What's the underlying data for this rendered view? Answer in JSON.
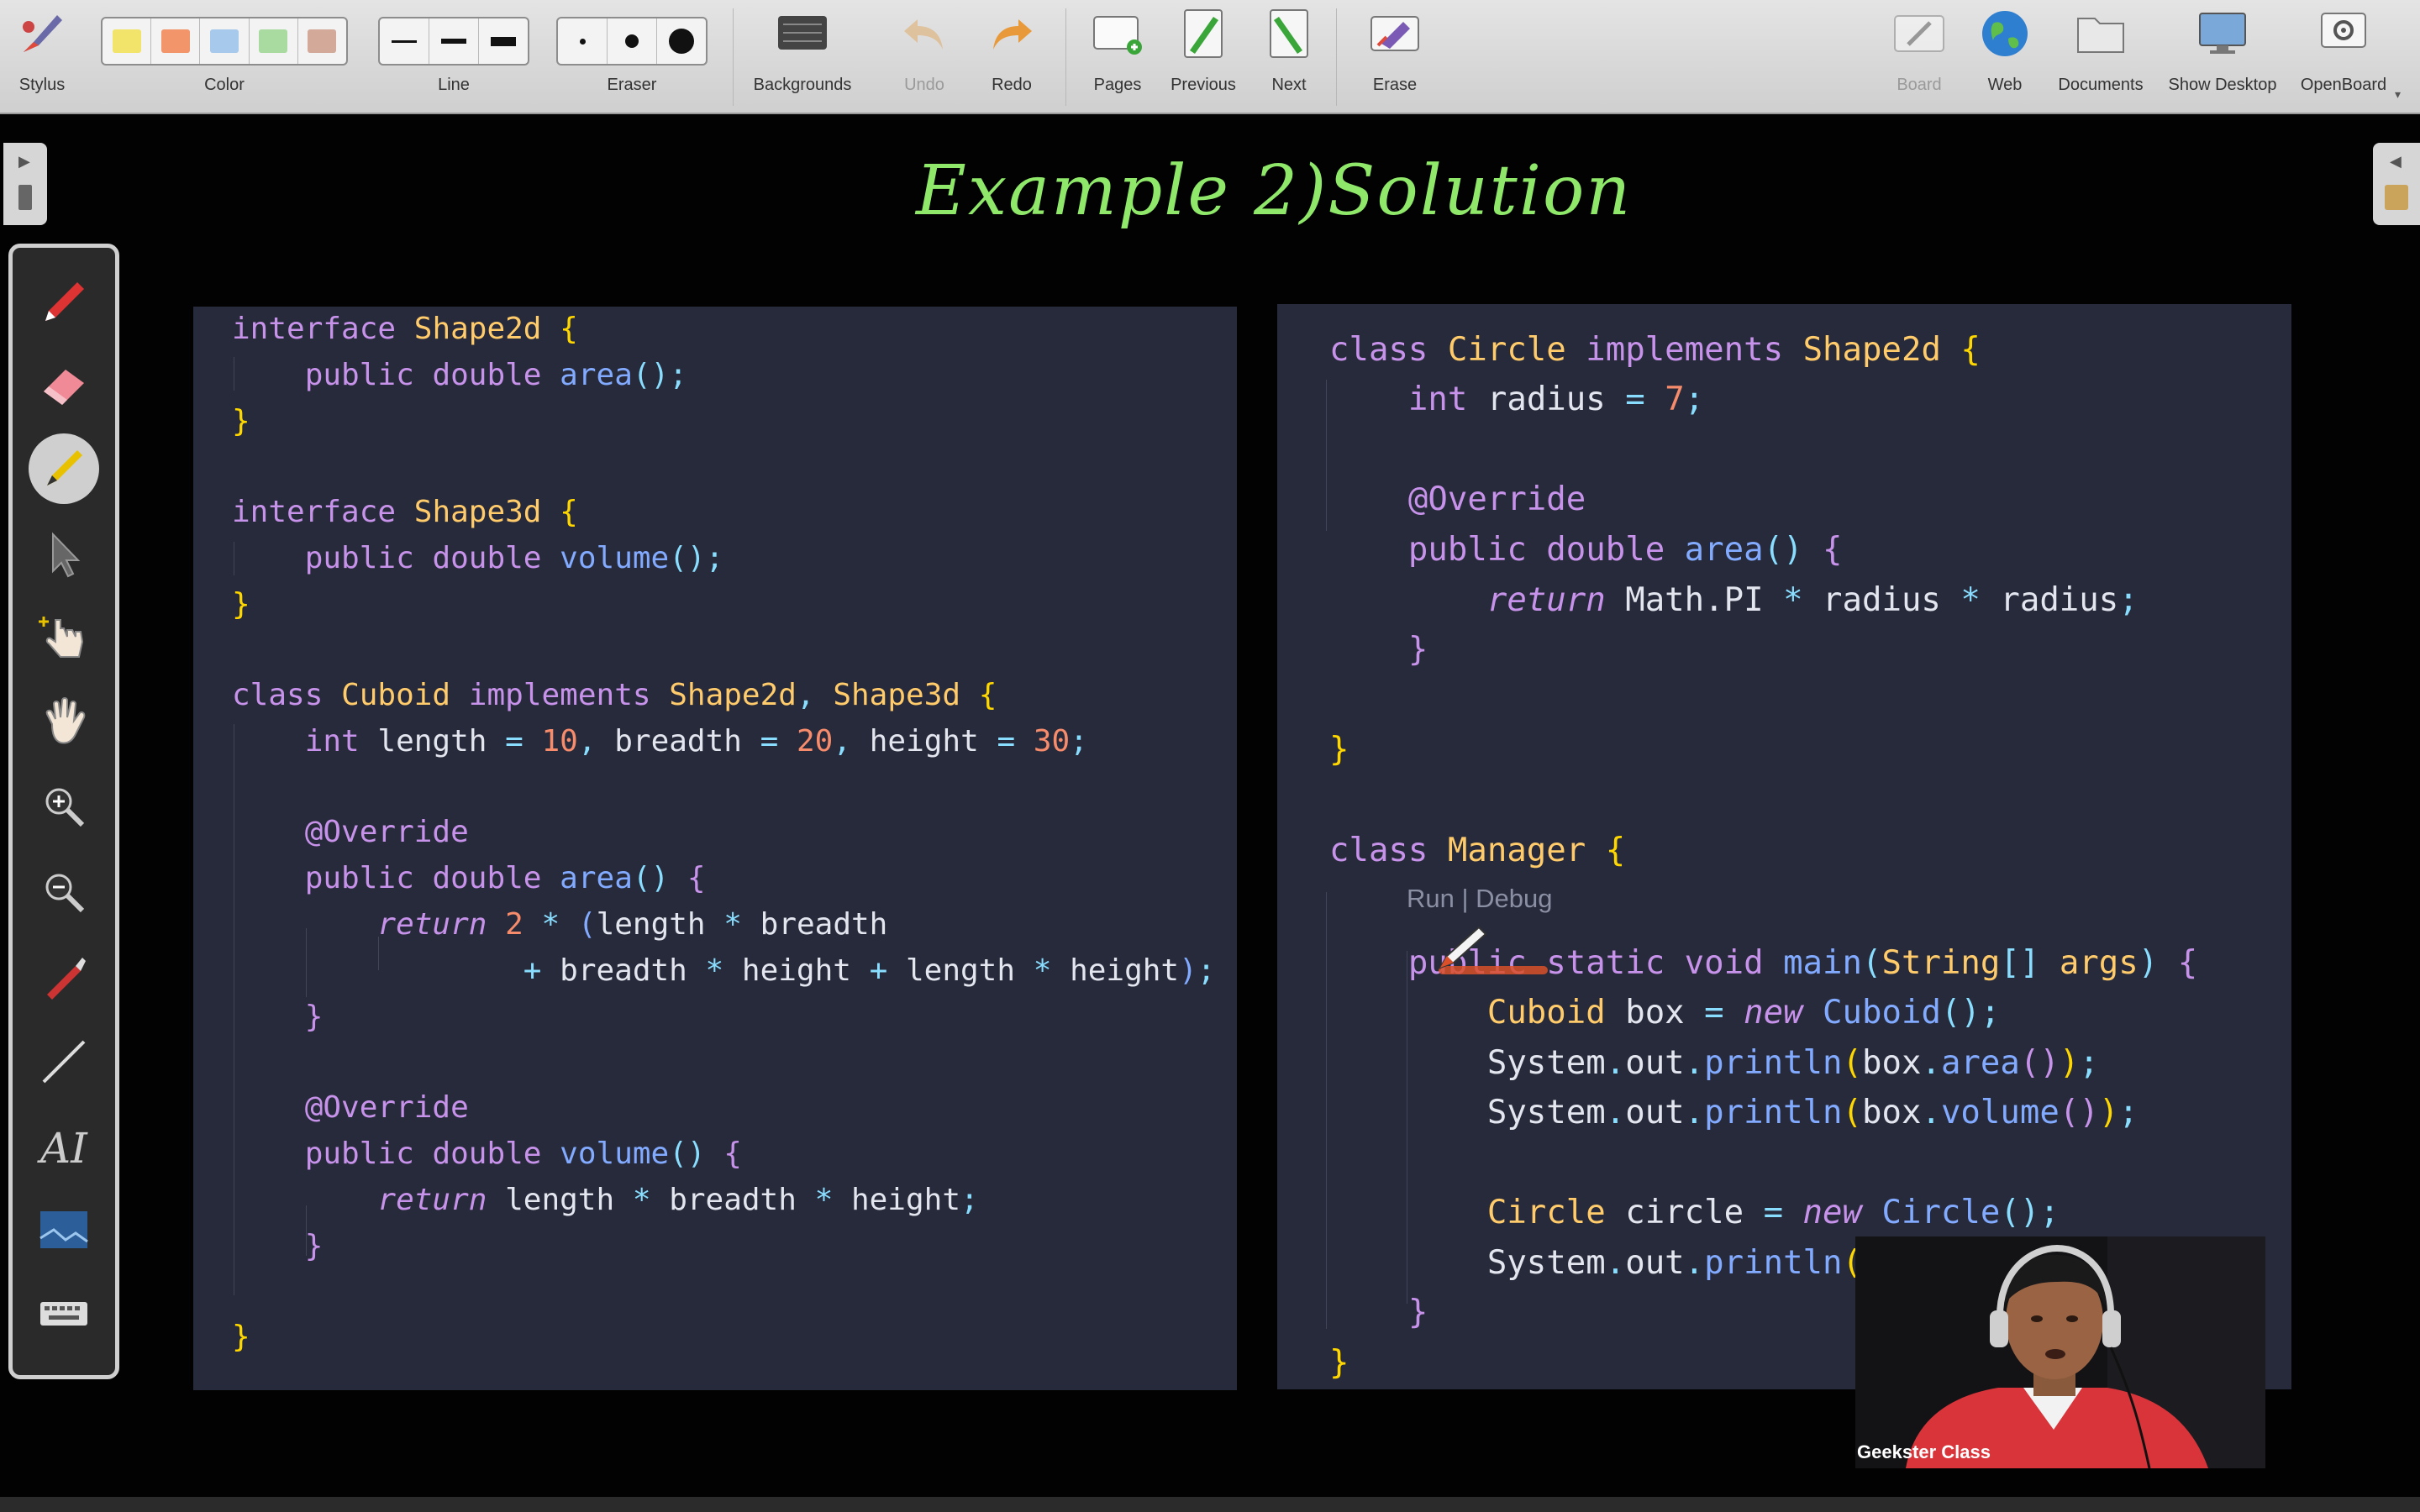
{
  "toolbar": {
    "stylus": {
      "label": "Stylus",
      "icon": "stylus-icon"
    },
    "color": {
      "label": "Color",
      "swatches": [
        "#f2e36b",
        "#f2956b",
        "#a7c9ec",
        "#a9dba0",
        "#d3a99a"
      ]
    },
    "line": {
      "label": "Line"
    },
    "eraser": {
      "label": "Eraser"
    },
    "backgrounds": {
      "label": "Backgrounds",
      "icon": "backgrounds-icon"
    },
    "undo": {
      "label": "Undo",
      "icon": "undo-icon"
    },
    "redo": {
      "label": "Redo",
      "icon": "redo-icon"
    },
    "pages": {
      "label": "Pages",
      "icon": "pages-icon"
    },
    "previous": {
      "label": "Previous",
      "icon": "previous-icon"
    },
    "next": {
      "label": "Next",
      "icon": "next-icon"
    },
    "erase": {
      "label": "Erase",
      "icon": "erase-icon"
    },
    "board": {
      "label": "Board",
      "icon": "board-icon"
    },
    "web": {
      "label": "Web",
      "icon": "web-icon"
    },
    "documents": {
      "label": "Documents",
      "icon": "documents-icon"
    },
    "show_desktop": {
      "label": "Show Desktop",
      "icon": "show-desktop-icon"
    },
    "openboard": {
      "label": "OpenBoard",
      "icon": "openboard-icon"
    }
  },
  "heading": "Example 2)Solution",
  "left_code": [
    [
      "interface Shape2d {"
    ],
    [
      "    public double area();"
    ],
    [
      "}"
    ],
    [
      ""
    ],
    [
      "interface Shape3d {"
    ],
    [
      "    public double volume();"
    ],
    [
      "}"
    ],
    [
      ""
    ],
    [
      "class Cuboid implements Shape2d, Shape3d {"
    ],
    [
      "    int length = 10, breadth = 20, height = 30;"
    ],
    [
      ""
    ],
    [
      "    @Override"
    ],
    [
      "    public double area() {"
    ],
    [
      "        return 2 * (length * breadth"
    ],
    [
      "                + breadth * height + length * height);"
    ],
    [
      "    }"
    ],
    [
      ""
    ],
    [
      "    @Override"
    ],
    [
      "    public double volume() {"
    ],
    [
      "        return length * breadth * height;"
    ],
    [
      "    }"
    ],
    [
      ""
    ],
    [
      "}"
    ]
  ],
  "right_code": {
    "codelens": "Run | Debug"
  },
  "webcam": {
    "name": "Geekster Class"
  }
}
